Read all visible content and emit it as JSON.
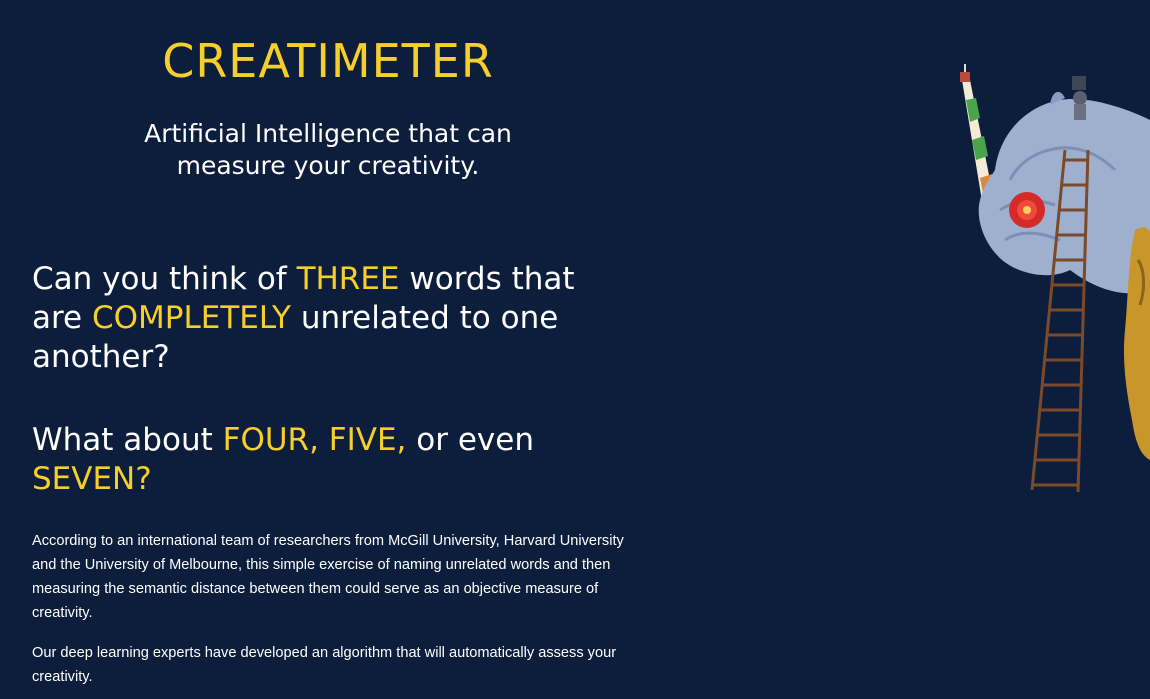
{
  "brand": {
    "title": "CREATIMETER",
    "tagline_line1": "Artificial Intelligence that can",
    "tagline_line2": "measure your creativity."
  },
  "question1": {
    "t1": "Can you think of ",
    "h1": "THREE",
    "t2": " words that are ",
    "h2": "COMPLETELY",
    "t3": " unrelated to one another?"
  },
  "question2": {
    "t1": "What about ",
    "h1": "FOUR, FIVE,",
    "t2": " or even ",
    "h2": "SEVEN?"
  },
  "body": {
    "paragraph1": "According to an international team of researchers from McGill University, Harvard University and the University of Melbourne, this simple exercise of naming unrelated words and then measuring the semantic distance between them could serve as an objective measure of creativity.",
    "paragraph2": "Our deep learning experts have developed an algorithm that will automatically assess your creativity."
  },
  "colors": {
    "background": "#0c1e3c",
    "accent": "#f6cf2a",
    "text": "#ffffff"
  },
  "illustration": {
    "icon": "rhino-ladder-collage-illustration"
  }
}
